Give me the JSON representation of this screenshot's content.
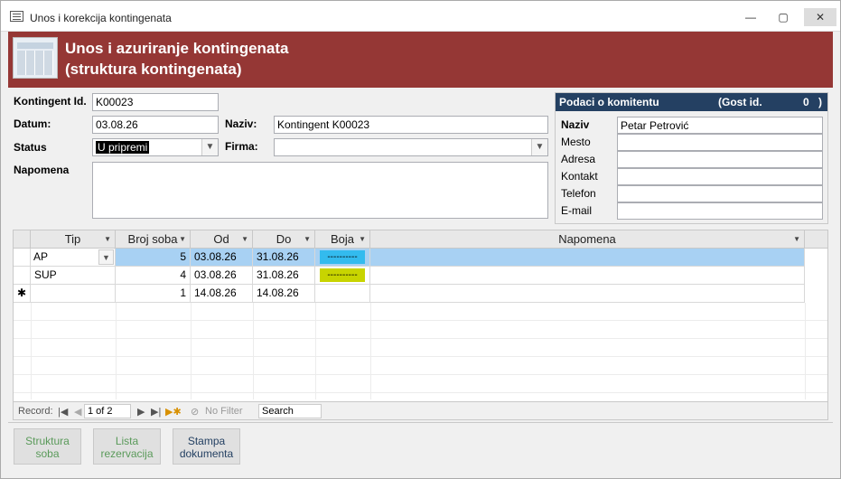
{
  "window": {
    "title": "Unos i korekcija kontingenata",
    "min": "—",
    "max": "▢",
    "close": "✕"
  },
  "header": {
    "line1": "Unos i azuriranje kontingenata",
    "line2": "(struktura kontingenata)"
  },
  "form": {
    "kontingent_label": "Kontingent Id.",
    "kontingent_value": "K00023",
    "datum_label": "Datum:",
    "datum_value": "03.08.26",
    "naziv_label": "Naziv:",
    "naziv_value": "Kontingent K00023",
    "status_label": "Status",
    "status_value": "U pripremi",
    "firma_label": "Firma:",
    "firma_value": "",
    "napomena_label": "Napomena",
    "napomena_value": ""
  },
  "client_panel": {
    "title": "Podaci o komitentu",
    "guest_label": "(Gost id.",
    "guest_id": "0",
    "guest_close": ")",
    "fields": [
      {
        "label": "Naziv",
        "value": "Petar Petrović"
      },
      {
        "label": "Mesto",
        "value": ""
      },
      {
        "label": "Adresa",
        "value": ""
      },
      {
        "label": "Kontakt",
        "value": ""
      },
      {
        "label": "Telefon",
        "value": ""
      },
      {
        "label": "E-mail",
        "value": ""
      }
    ]
  },
  "table": {
    "columns": [
      "Tip",
      "Broj soba",
      "Od",
      "Do",
      "Boja",
      "Napomena"
    ],
    "rows": [
      {
        "tip": "AP",
        "broj": "5",
        "od": "03.08.26",
        "do": "31.08.26",
        "boja": "----------",
        "boja_color": "#33bbee",
        "napomena": ""
      },
      {
        "tip": "SUP",
        "broj": "4",
        "od": "03.08.26",
        "do": "31.08.26",
        "boja": "----------",
        "boja_color": "#c8d400",
        "napomena": ""
      },
      {
        "tip": "",
        "broj": "1",
        "od": "14.08.26",
        "do": "14.08.26",
        "boja": "",
        "boja_color": "",
        "napomena": ""
      }
    ],
    "new_row_marker": "✱"
  },
  "navigator": {
    "record_label": "Record:",
    "position": "1 of 2",
    "filter_label": "No Filter",
    "search_placeholder": "Search"
  },
  "buttons": {
    "struktura": "Struktura soba",
    "lista": "Lista rezervacija",
    "stampa": "Stampa dokumenta"
  },
  "colors": {
    "header_bg": "#953735",
    "panel_header": "#244062",
    "selected_row": "#a8d1f3"
  }
}
